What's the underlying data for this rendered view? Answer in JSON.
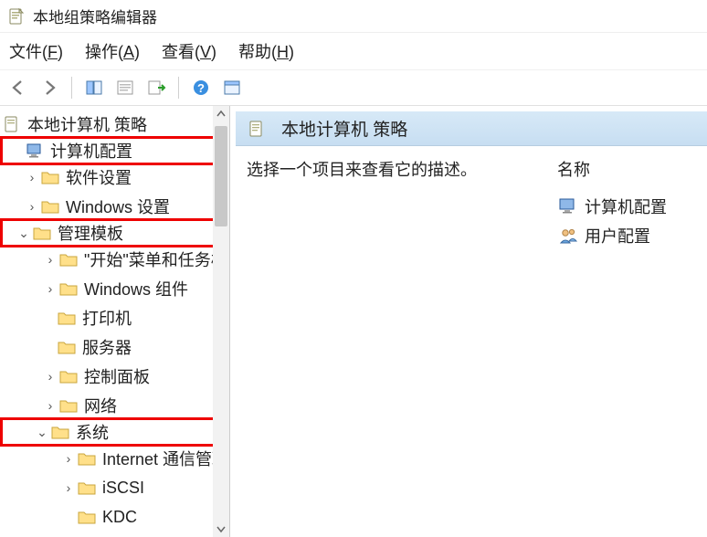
{
  "window": {
    "title": "本地组策略编辑器"
  },
  "menu": {
    "file_label": "文件",
    "file_accel": "F",
    "action_label": "操作",
    "action_accel": "A",
    "view_label": "查看",
    "view_accel": "V",
    "help_label": "帮助",
    "help_accel": "H"
  },
  "tree": {
    "root": "本地计算机 策略",
    "computer_config": "计算机配置",
    "software_settings": "软件设置",
    "windows_settings": "Windows 设置",
    "admin_templates": "管理模板",
    "start_menu_taskbar": "\"开始\"菜单和任务栏",
    "windows_components": "Windows 组件",
    "printers": "打印机",
    "servers": "服务器",
    "control_panel": "控制面板",
    "network": "网络",
    "system": "系统",
    "internet_comm": "Internet 通信管理",
    "iscsi": "iSCSI",
    "kdc": "KDC"
  },
  "content": {
    "header_title": "本地计算机 策略",
    "description": "选择一个项目来查看它的描述。",
    "name_header": "名称",
    "items": {
      "computer_config": "计算机配置",
      "user_config": "用户配置"
    }
  }
}
